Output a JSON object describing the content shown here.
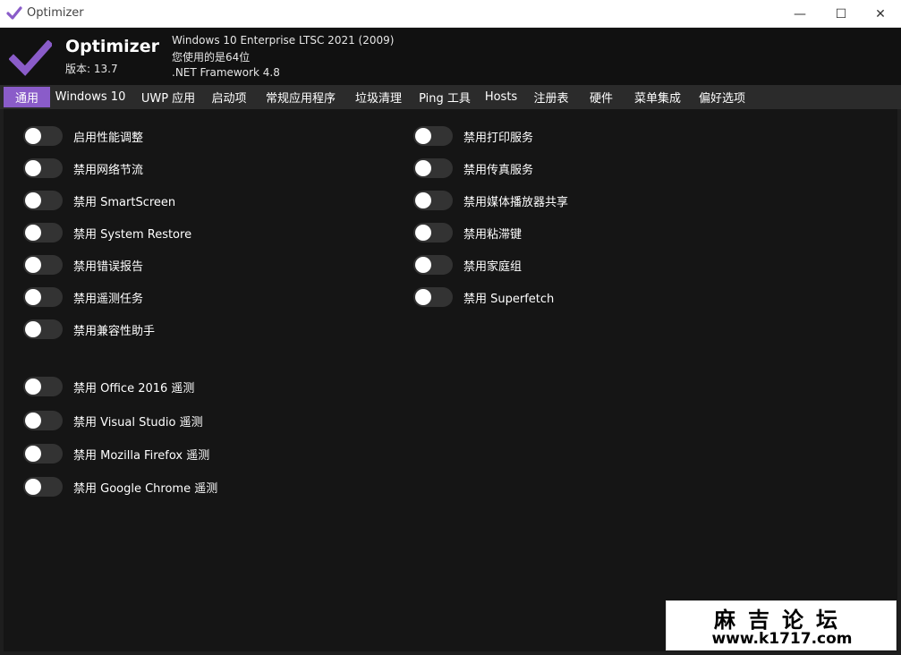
{
  "window": {
    "title": "Optimizer",
    "minimize_glyph": "—",
    "maximize_glyph": "☐",
    "close_glyph": "✕"
  },
  "header": {
    "app_name": "Optimizer",
    "version": "版本: 13.7",
    "os_info": "Windows 10 Enterprise LTSC 2021 (2009)",
    "arch_info": "您使用的是64位",
    "framework_info": ".NET Framework 4.8",
    "logo_color": "#8a5cc9"
  },
  "tabs": [
    {
      "label": "通用",
      "active": true
    },
    {
      "label": "Windows 10"
    },
    {
      "label": "UWP 应用"
    },
    {
      "label": "启动项"
    },
    {
      "label": "常规应用程序"
    },
    {
      "label": "垃圾清理"
    },
    {
      "label": "Ping 工具"
    },
    {
      "label": "Hosts"
    },
    {
      "label": "注册表"
    },
    {
      "label": "硬件"
    },
    {
      "label": "菜单集成"
    },
    {
      "label": "偏好选项"
    }
  ],
  "left_toggles": [
    {
      "label": "启用性能调整",
      "on": false
    },
    {
      "label": "禁用网络节流",
      "on": false
    },
    {
      "label": "禁用 SmartScreen",
      "on": false
    },
    {
      "label": "禁用 System Restore",
      "on": false
    },
    {
      "label": "禁用错误报告",
      "on": false
    },
    {
      "label": "禁用遥测任务",
      "on": false
    },
    {
      "label": "禁用兼容性助手",
      "on": false
    }
  ],
  "right_toggles": [
    {
      "label": "禁用打印服务",
      "on": false
    },
    {
      "label": "禁用传真服务",
      "on": false
    },
    {
      "label": "禁用媒体播放器共享",
      "on": false
    },
    {
      "label": "禁用粘滞键",
      "on": false
    },
    {
      "label": "禁用家庭组",
      "on": false
    },
    {
      "label": "禁用 Superfetch",
      "on": false
    }
  ],
  "telemetry_toggles": [
    {
      "label": "禁用 Office 2016 遥测",
      "on": false
    },
    {
      "label": "禁用 Visual Studio 遥测",
      "on": false
    },
    {
      "label": "禁用 Mozilla Firefox 遥测",
      "on": false
    },
    {
      "label": "禁用 Google Chrome 遥测",
      "on": false
    }
  ],
  "watermark": {
    "title": "麻吉论坛",
    "url": "www.k1717.com"
  }
}
